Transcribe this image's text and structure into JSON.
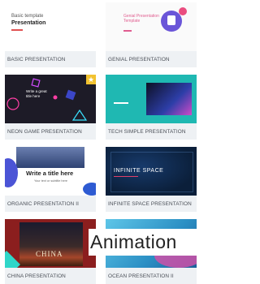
{
  "templates": [
    {
      "label": "BASIC PRESENTATION",
      "thumb_title": "Basic template",
      "thumb_subtitle": "Presentation"
    },
    {
      "label": "GENIAL PRESENTATION",
      "thumb_title": "Genial Presentation Template"
    },
    {
      "label": "NEON GAME PRESENTATION",
      "thumb_title": "Write a great title here"
    },
    {
      "label": "TECH SIMPLE PRESENTATION"
    },
    {
      "label": "ORGANIC PRESENTATION II",
      "thumb_title": "Write a title here",
      "thumb_subtitle": "Your text or subtitle here"
    },
    {
      "label": "INFINITE SPACE PRESENTATION",
      "thumb_title": "INFINITE SPACE"
    },
    {
      "label": "CHINA PRESENTATION",
      "thumb_title": "CHINA"
    },
    {
      "label": "OCEAN PRESENTATION II"
    }
  ],
  "overlay_text": "Animation",
  "colors": {
    "label_bg": "#eef1f4",
    "teal": "#1fb8b2",
    "neon_bg": "#1d1b27",
    "space_bg": "#0b1f3a"
  }
}
